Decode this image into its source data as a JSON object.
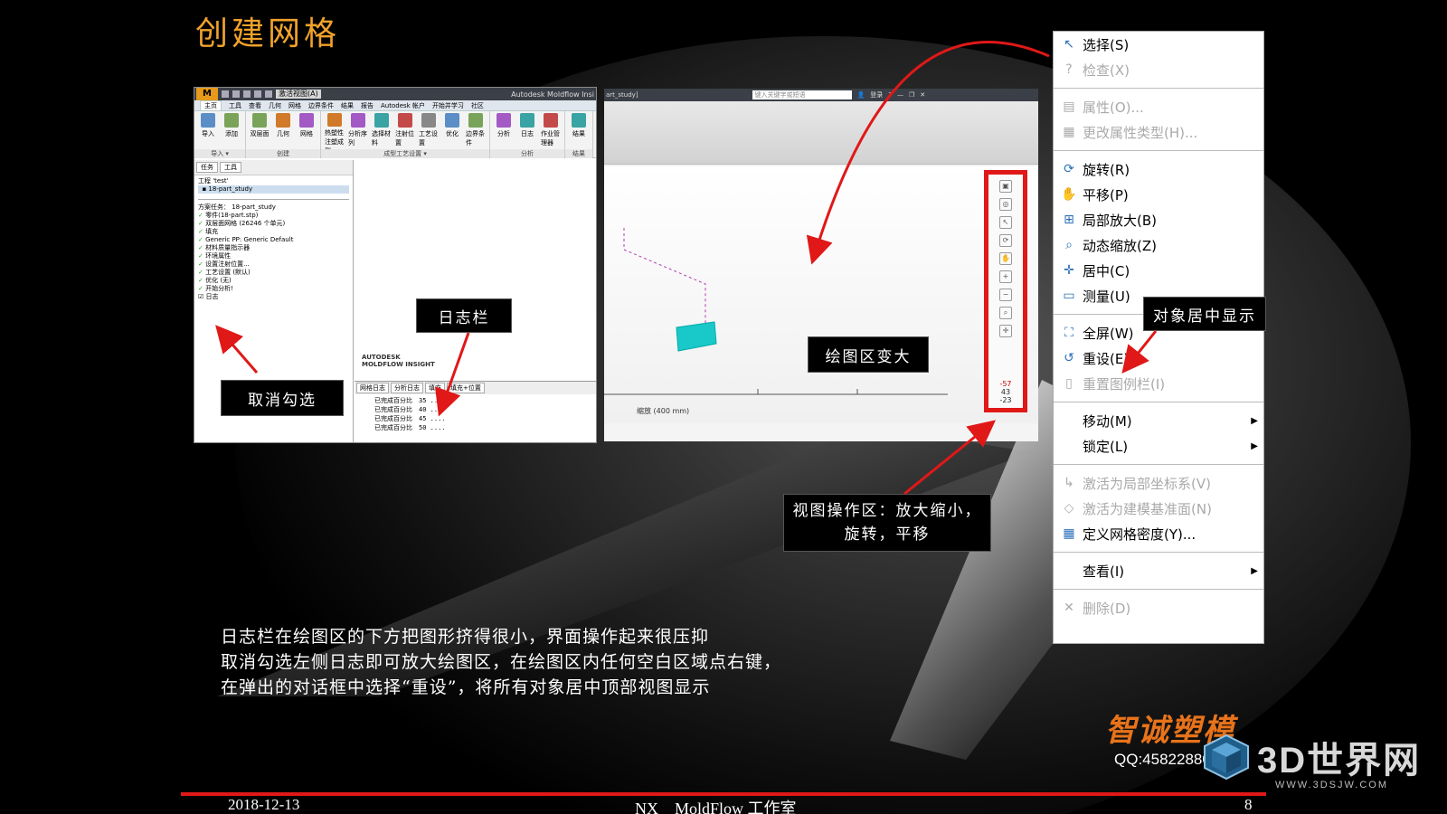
{
  "slide": {
    "title": "创建网格",
    "body_lines": [
      "日志栏在绘图区的下方把图形挤得很小，界面操作起来很压抑",
      "取消勾选左侧日志即可放大绘图区，在绘图区内任何空白区域点右键，",
      "在弹出的对话框中选择“重设”，将所有对象居中顶部视图显示"
    ],
    "brand": "智诚塑模",
    "qq": "QQ:458228801",
    "site_name": "3D世界网",
    "site_url": "WWW.3DSJW.COM",
    "footer": {
      "date": "2018-12-13",
      "center": "NX　MoldFlow 工作室",
      "page": "8"
    },
    "accent": "#e01818",
    "title_color": "#f0a22a",
    "brand_color": "#e8731a"
  },
  "callouts": {
    "uncheck": "取消勾选",
    "log_bar": "日志栏",
    "plot_bigger": "绘图区变大",
    "center_objects": "对象居中显示",
    "view_ops_line1": "视图操作区：放大缩小，",
    "view_ops_line2": "旋转，平移"
  },
  "left_shot": {
    "logo": "M",
    "qa_dropdown": "激活视图(A)",
    "app_title": "Autodesk Moldflow Insi",
    "tabs": [
      "主页",
      "工具",
      "查看",
      "几何",
      "网格",
      "边界条件",
      "结果",
      "报告",
      "Autodesk 帐户",
      "开始并学习",
      "社区"
    ],
    "ribbon_groups": [
      {
        "label": "导入 ▾",
        "buttons": [
          "导入",
          "添加"
        ]
      },
      {
        "label": "创建",
        "buttons": [
          "双层面",
          "几何",
          "网格"
        ]
      },
      {
        "label": "成型工艺设置 ▾",
        "buttons": [
          "热塑性注塑成型",
          "分析序列",
          "选择材料",
          "注射位置",
          "工艺设置",
          "优化",
          "边界条件"
        ]
      },
      {
        "label": "分析",
        "buttons": [
          "分析",
          "日志",
          "作业管理器"
        ]
      },
      {
        "label": "结果",
        "buttons": [
          "结果"
        ]
      }
    ],
    "pane_tabs": [
      "任务",
      "工具"
    ],
    "project": "工程 'test'",
    "study": "18-part_study",
    "task_header": "方案任务： 18-part_study",
    "tasks": [
      "零件(18-part.stp)",
      "双层面网格 (26246 个单元)",
      "填充",
      "Generic PP: Generic Default",
      "材料质量指示器",
      "环境属性",
      "设置注射位置...",
      "工艺设置 (默认)",
      "优化 (无)",
      "开始分析!",
      "日志"
    ],
    "watermark_line1": "AUTODESK",
    "watermark_line2": "MOLDFLOW INSIGHT",
    "log_tabs": [
      "网格日志",
      "分析日志",
      "填充",
      "填充+位置"
    ],
    "log_lines": [
      "已完成百分比　35  ....",
      "已完成百分比　40  ....",
      "已完成百分比　45  ....",
      "已完成百分比　50  ...."
    ]
  },
  "right_shot": {
    "study_tab": "art_study]",
    "search_placeholder": "键入关键字或短语",
    "login": "登录",
    "scale_label": "缩放 (400 mm)",
    "view_numbers": [
      "-57",
      "43",
      "-23"
    ]
  },
  "context_menu": {
    "items": [
      {
        "label": "选择(S)",
        "icon": "cursor-icon",
        "glyph": "↖",
        "disabled": false,
        "submenu": false
      },
      {
        "label": "检查(X)",
        "icon": "inspect-icon",
        "glyph": "?",
        "disabled": true,
        "submenu": false
      },
      {
        "sep": true
      },
      {
        "label": "属性(O)...",
        "icon": "properties-icon",
        "glyph": "▤",
        "disabled": true,
        "submenu": false
      },
      {
        "label": "更改属性类型(H)...",
        "icon": "change-type-icon",
        "glyph": "▦",
        "disabled": true,
        "submenu": false
      },
      {
        "sep": true
      },
      {
        "label": "旋转(R)",
        "icon": "rotate-icon",
        "glyph": "⟳",
        "disabled": false,
        "submenu": false
      },
      {
        "label": "平移(P)",
        "icon": "pan-hand-icon",
        "glyph": "✋",
        "disabled": false,
        "submenu": false
      },
      {
        "label": "局部放大(B)",
        "icon": "zoom-box-icon",
        "glyph": "⊞",
        "disabled": false,
        "submenu": false
      },
      {
        "label": "动态缩放(Z)",
        "icon": "zoom-dynamic-icon",
        "glyph": "⌕",
        "disabled": false,
        "submenu": false
      },
      {
        "label": "居中(C)",
        "icon": "center-icon",
        "glyph": "✛",
        "disabled": false,
        "submenu": false
      },
      {
        "label": "测量(U)",
        "icon": "ruler-icon",
        "glyph": "▭",
        "disabled": false,
        "submenu": false
      },
      {
        "sep": true
      },
      {
        "label": "全屏(W)",
        "icon": "fullscreen-icon",
        "glyph": "⛶",
        "disabled": false,
        "submenu": false
      },
      {
        "label": "重设(E)",
        "icon": "reset-icon",
        "glyph": "↺",
        "disabled": false,
        "submenu": false
      },
      {
        "label": "重置图例栏(I)",
        "icon": "legend-icon",
        "glyph": "▯",
        "disabled": true,
        "submenu": false
      },
      {
        "sep": true
      },
      {
        "label": "移动(M)",
        "icon": "",
        "glyph": "",
        "disabled": false,
        "submenu": true
      },
      {
        "label": "锁定(L)",
        "icon": "",
        "glyph": "",
        "disabled": false,
        "submenu": true
      },
      {
        "sep": true
      },
      {
        "label": "激活为局部坐标系(V)",
        "icon": "local-coord-icon",
        "glyph": "↳",
        "disabled": true,
        "submenu": false
      },
      {
        "label": "激活为建模基准面(N)",
        "icon": "datum-plane-icon",
        "glyph": "◇",
        "disabled": true,
        "submenu": false
      },
      {
        "label": "定义网格密度(Y)...",
        "icon": "mesh-density-icon",
        "glyph": "▦",
        "disabled": false,
        "submenu": false
      },
      {
        "sep": true
      },
      {
        "label": "查看(I)",
        "icon": "",
        "glyph": "",
        "disabled": false,
        "submenu": true
      },
      {
        "sep": true
      },
      {
        "label": "删除(D)",
        "icon": "delete-icon",
        "glyph": "✕",
        "disabled": true,
        "submenu": false
      }
    ]
  }
}
